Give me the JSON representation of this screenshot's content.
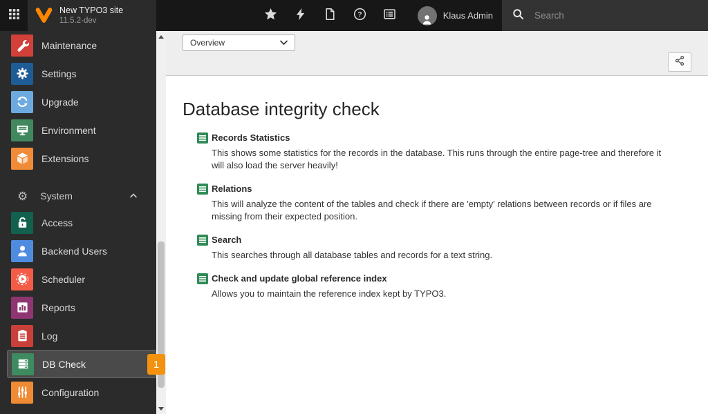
{
  "topbar": {
    "site_name": "New TYPO3 site",
    "version": "11.5.2-dev",
    "user_name": "Klaus Admin",
    "search_placeholder": "Search"
  },
  "icons": {
    "help_glyph": "?",
    "system_gear": "⚙"
  },
  "colors": {
    "badge": "#f2920e",
    "maintenance": "#d2403a",
    "settings": "#1e5c96",
    "upgrade": "#6daae0",
    "environment": "#41885e",
    "extensions": "#f08b38",
    "access": "#13604f",
    "backend_users": "#4f8ce0",
    "scheduler": "#f55c47",
    "reports": "#8e3572",
    "log": "#c9403a",
    "db_check": "#3d8b5f",
    "configuration": "#ef8b34",
    "content_icon_green": "#2f8a55"
  },
  "sidebar": {
    "modules": [
      {
        "label": "Maintenance"
      },
      {
        "label": "Settings"
      },
      {
        "label": "Upgrade"
      },
      {
        "label": "Environment"
      },
      {
        "label": "Extensions"
      }
    ],
    "system": {
      "label": "System",
      "items": [
        {
          "label": "Access"
        },
        {
          "label": "Backend Users"
        },
        {
          "label": "Scheduler"
        },
        {
          "label": "Reports"
        },
        {
          "label": "Log"
        },
        {
          "label": "DB Check",
          "badge": "1"
        },
        {
          "label": "Configuration"
        }
      ]
    }
  },
  "docheader": {
    "module_dropdown": "Overview"
  },
  "main": {
    "title": "Database integrity check",
    "checks": [
      {
        "title": "Records Statistics",
        "description": "This shows some statistics for the records in the database. This runs through the entire page-tree and therefore it will also load the server heavily!"
      },
      {
        "title": "Relations",
        "description": "This will analyze the content of the tables and check if there are 'empty' relations between records or if files are missing from their expected position."
      },
      {
        "title": "Search",
        "description": "This searches through all database tables and records for a text string."
      },
      {
        "title": "Check and update global reference index",
        "description": "Allows you to maintain the reference index kept by TYPO3."
      }
    ]
  }
}
